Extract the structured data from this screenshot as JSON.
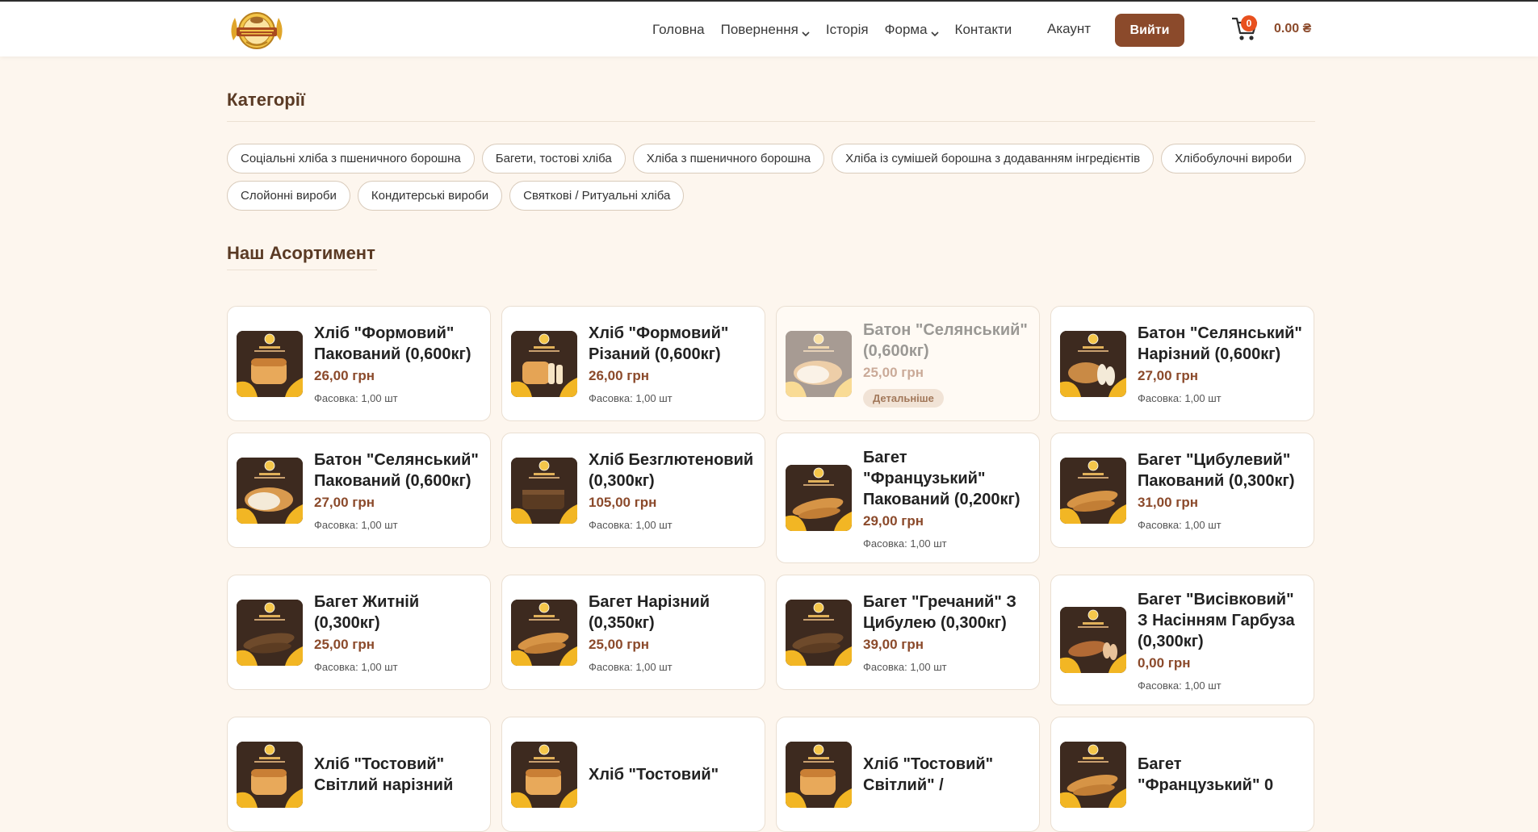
{
  "header": {
    "nav": [
      {
        "label": "Головна",
        "dropdown": false
      },
      {
        "label": "Повернення",
        "dropdown": true
      },
      {
        "label": "Історія",
        "dropdown": false
      },
      {
        "label": "Форма",
        "dropdown": true
      },
      {
        "label": "Контакти",
        "dropdown": false
      }
    ],
    "account_label": "Акаунт",
    "logout_label": "Вийти",
    "cart_count": "0",
    "cart_total": "0.00 ₴"
  },
  "categories": {
    "title": "Категорії",
    "items": [
      "Соціальні хліба з пшеничного борошна",
      "Багети, тостові хліба",
      "Хліба з пшеничного борошна",
      "Хліба із сумішей борошна з додаванням інгредієнтів",
      "Хлібобулочні вироби",
      "Слойонні вироби",
      "Кондитерські вироби",
      "Святкові / Ритуальні хліба"
    ]
  },
  "assortment": {
    "title": "Наш Асортимент",
    "products": [
      {
        "name": "Хліб \"Формовий\" Пакований (0,600кг)",
        "price": "26,00 грн",
        "pack": "Фасовка: 1,00 шт",
        "bread": "loaf"
      },
      {
        "name": "Хліб \"Формовий\" Різаний (0,600кг)",
        "price": "26,00 грн",
        "pack": "Фасовка: 1,00 шт",
        "bread": "sliced-loaf"
      },
      {
        "name": "Батон \"Селянський\" (0,600кг)",
        "price": "25,00 грн",
        "pack": "",
        "details": "Детальніше",
        "dim": true,
        "bread": "baton"
      },
      {
        "name": "Батон \"Селянський\" Нарізний (0,600кг)",
        "price": "27,00 грн",
        "pack": "Фасовка: 1,00 шт",
        "bread": "sliced-baton"
      },
      {
        "name": "Батон \"Селянський\" Пакований (0,600кг)",
        "price": "27,00 грн",
        "pack": "Фасовка: 1,00 шт",
        "bread": "baton"
      },
      {
        "name": "Хліб Безглютеновий (0,300кг)",
        "price": "105,00 грн",
        "pack": "Фасовка: 1,00 шт",
        "bread": "dark-loaf"
      },
      {
        "name": "Багет \"Французький\" Пакований (0,200кг)",
        "price": "29,00 грн",
        "pack": "Фасовка: 1,00 шт",
        "bread": "baguette",
        "tall": true
      },
      {
        "name": "Багет \"Цибулевий\" Пакований (0,300кг)",
        "price": "31,00 грн",
        "pack": "Фасовка: 1,00 шт",
        "bread": "baguette"
      },
      {
        "name": "Багет Житній (0,300кг)",
        "price": "25,00 грн",
        "pack": "Фасовка: 1,00 шт",
        "bread": "rye-baguette"
      },
      {
        "name": "Багет Нарізний (0,350кг)",
        "price": "25,00 грн",
        "pack": "Фасовка: 1,00 шт",
        "bread": "baguette"
      },
      {
        "name": "Багет \"Гречаний\" З Цибулею (0,300кг)",
        "price": "39,00 грн",
        "pack": "Фасовка: 1,00 шт",
        "bread": "rye-baguette"
      },
      {
        "name": "Багет \"Висівковий\" З Насінням Гарбуза (0,300кг)",
        "price": "0,00 грн",
        "pack": "Фасовка: 1,00 шт",
        "bread": "sliced-baguette",
        "tall": true
      },
      {
        "name": "Хліб \"Тостовий\" Світлий нарізний",
        "price": "",
        "pack": "",
        "bread": "loaf"
      },
      {
        "name": "Хліб \"Тостовий\"",
        "price": "",
        "pack": "",
        "bread": "loaf"
      },
      {
        "name": "Хліб \"Тостовий\" Світлий\" /",
        "price": "",
        "pack": "",
        "bread": "loaf"
      },
      {
        "name": "Багет \"Французький\" 0",
        "price": "",
        "pack": "",
        "bread": "baguette"
      }
    ]
  },
  "colors": {
    "accent": "#8b4a2b",
    "background": "#fdf6ee",
    "badge": "#e8501e"
  }
}
